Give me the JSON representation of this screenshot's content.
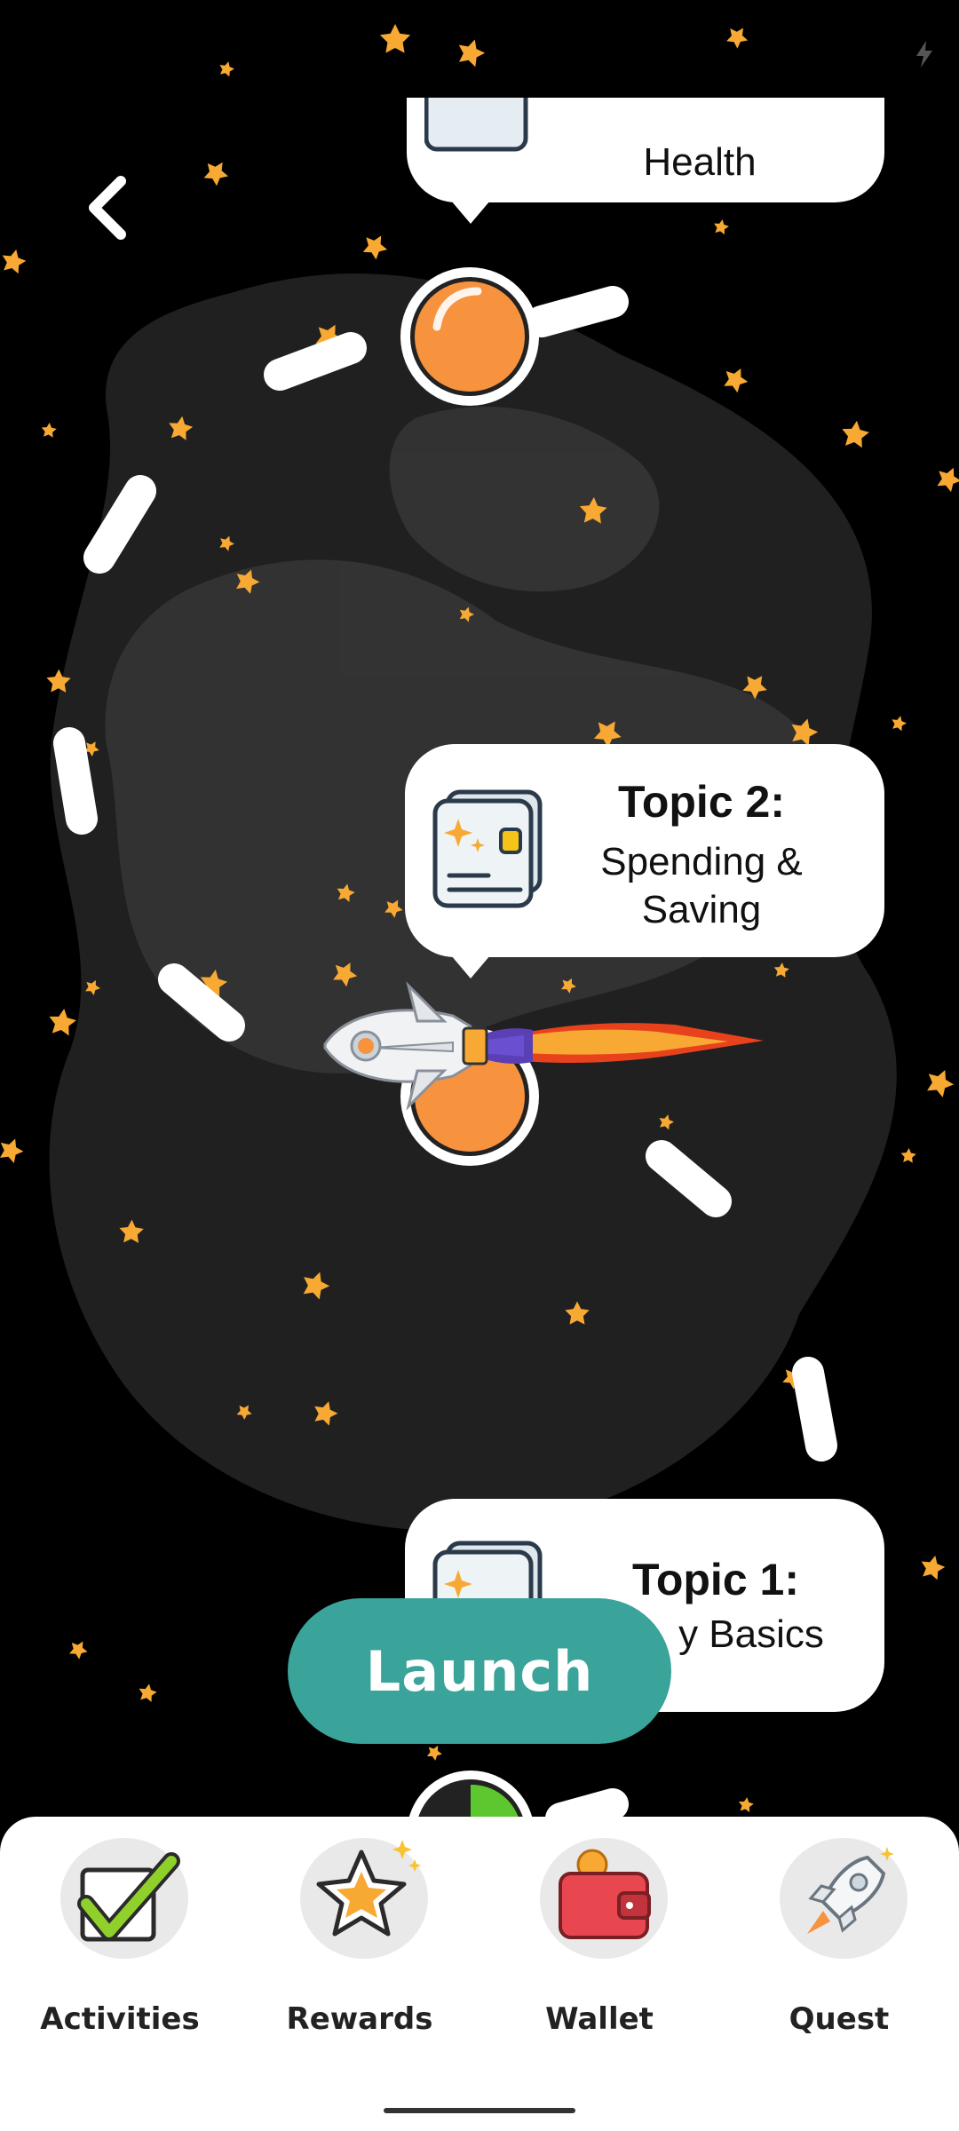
{
  "colors": {
    "background": "#000000",
    "star": "#f7a933",
    "node": "#f7923f",
    "accent": "#3aa39a",
    "path": "#ffffff"
  },
  "status_bar": {
    "icon": "flash-icon"
  },
  "header": {
    "back_icon": "chevron-left-icon"
  },
  "topics": [
    {
      "title": "",
      "subtitle": "Health",
      "icon": "card-icon"
    },
    {
      "title": "Topic 2:",
      "subtitle_line1": "Spending &",
      "subtitle_line2": "Saving",
      "icon": "card-icon"
    },
    {
      "title": "Topic 1:",
      "subtitle": "y Basics",
      "icon": "card-icon"
    }
  ],
  "launch_button": {
    "label": "Launch"
  },
  "bottom_nav": {
    "items": [
      {
        "label": "Activities",
        "icon": "checkmark-icon"
      },
      {
        "label": "Rewards",
        "icon": "star-icon"
      },
      {
        "label": "Wallet",
        "icon": "wallet-icon"
      },
      {
        "label": "Quest",
        "icon": "rocket-icon"
      }
    ]
  }
}
